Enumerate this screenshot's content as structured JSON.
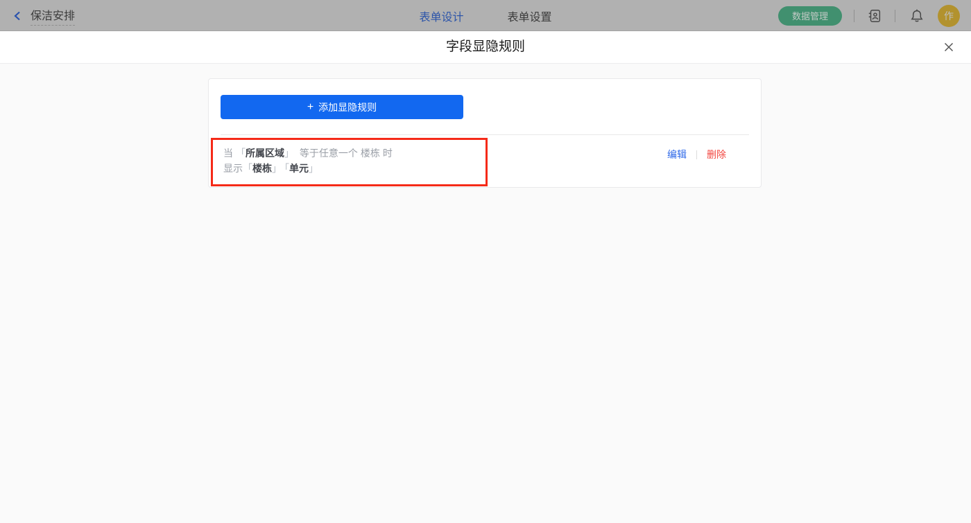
{
  "topbar": {
    "back_label": "保洁安排",
    "tabs": [
      {
        "label": "表单设计"
      },
      {
        "label": "表单设置"
      }
    ],
    "data_manage_label": "数据管理",
    "avatar_text": "作"
  },
  "modal": {
    "title": "字段显隐规则"
  },
  "card": {
    "plus": "+",
    "add_rule_label": "添加显隐规则",
    "brackets": {
      "open": "「",
      "close": "」"
    },
    "rules": [
      {
        "when_label": "当",
        "field": "所属区域",
        "operator": "等于任意一个",
        "value": "楼栋",
        "when_suffix": "时",
        "show_label": "显示",
        "show_fields": [
          "楼栋",
          "单元"
        ],
        "edit_label": "编辑",
        "delete_label": "删除"
      }
    ]
  },
  "colors": {
    "accent-blue": "#1268f0",
    "link-blue": "#2e68e8",
    "danger-red": "#f2453f",
    "annotation-red": "#f52a18",
    "topbar-green": "#41906f",
    "avatar-gold": "#b2922e",
    "tab-active-blue": "#2d55a9"
  }
}
